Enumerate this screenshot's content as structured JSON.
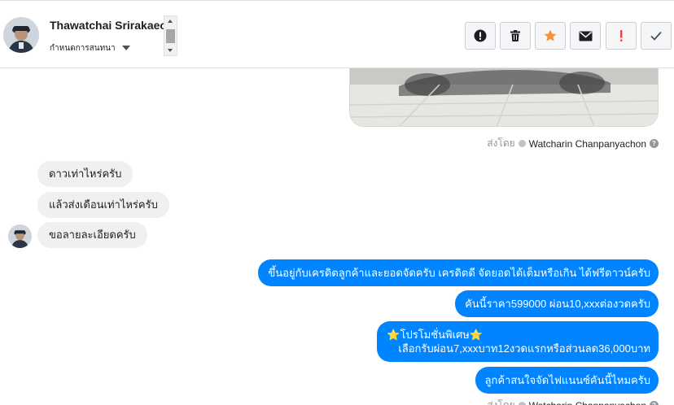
{
  "header": {
    "contact_name": "Thawatchai Srirakaeo",
    "assign_label": "กำหนดการสนทนา",
    "actions": [
      {
        "name": "report-button",
        "icon": "alert-circle-icon"
      },
      {
        "name": "delete-button",
        "icon": "trash-icon"
      },
      {
        "name": "star-button",
        "icon": "star-icon",
        "color": "#f7923a"
      },
      {
        "name": "mark-unread-button",
        "icon": "envelope-icon"
      },
      {
        "name": "flag-important-button",
        "icon": "exclamation-icon",
        "color": "#fa3e3e"
      },
      {
        "name": "mark-done-button",
        "icon": "checkmark-icon"
      }
    ]
  },
  "conversation": {
    "sent_by_prefix": "ส่งโดย",
    "sender": "Watcharin Chanpanyachon",
    "help_glyph": "?",
    "incoming": [
      "ดาวเท่าไหร่ครับ",
      "แล้วส่งเดือนเท่าไหร่ครับ",
      "ขอลายละเอียดครับ"
    ],
    "outgoing": [
      "ขึ้นอยู่กับเครดิตลูกค้าและยอดจัดครับ เครดิตดี จัดยอดได้เต็มหรือเกิน ได้ฟรีดาวน์ครับ",
      "คันนี้ราคา599000 ผ่อน10,xxxต่องวดครับ",
      {
        "line1": "โปรโมชั่นพิเศษ",
        "line2": "เลือกรับผ่อน7,xxxบาท12งวดแรกหรือส่วนลด36,000บาท",
        "star": "⭐"
      },
      "ลูกค้าสนใจจัดไฟแนนซ์คันนี้ไหมครับ"
    ]
  },
  "colors": {
    "outgoing_bubble": "#0084ff",
    "incoming_bubble": "#f1f0f0",
    "accent_star": "#f7923a",
    "accent_red": "#fa3e3e"
  }
}
